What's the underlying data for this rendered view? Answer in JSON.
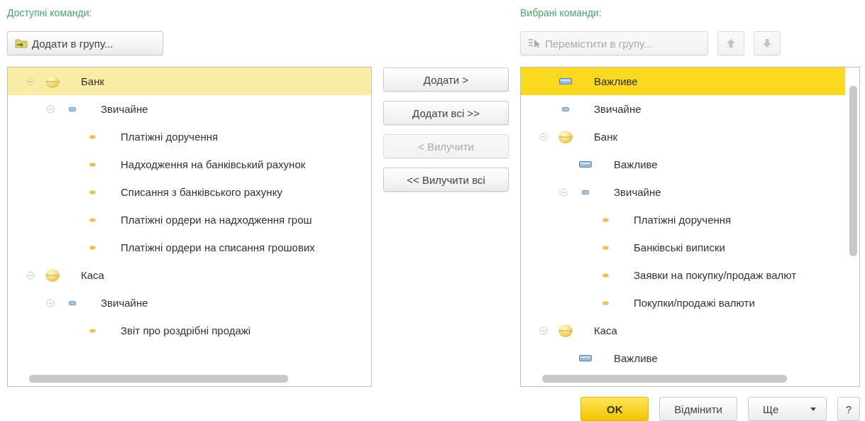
{
  "available": {
    "label": "Доступні команди:",
    "toolbar": [
      {
        "kind": "add-group",
        "label": "Додати в групу...",
        "disabled": false
      }
    ],
    "tree": {
      "focused": false,
      "items": [
        {
          "kind": "group",
          "label": "Банк",
          "selected": true,
          "expanded": true,
          "children": [
            {
              "kind": "normal",
              "label": "Звичайне",
              "selected": false,
              "expanded": true,
              "children": [
                {
                  "kind": "command",
                  "label": "Платіжні доручення",
                  "selected": false
                },
                {
                  "kind": "command",
                  "label": "Надходження на банківський рахунок",
                  "selected": false
                },
                {
                  "kind": "command",
                  "label": "Списання з банківського рахунку",
                  "selected": false
                },
                {
                  "kind": "command",
                  "label": "Платіжні ордери на надходження грош",
                  "selected": false
                },
                {
                  "kind": "command",
                  "label": "Платіжні ордери на списання грошових",
                  "selected": false
                }
              ]
            }
          ]
        },
        {
          "kind": "group",
          "label": "Каса",
          "selected": false,
          "expanded": true,
          "children": [
            {
              "kind": "normal",
              "label": "Звичайне",
              "selected": false,
              "expanded": true,
              "children": [
                {
                  "kind": "command",
                  "label": "Звіт про роздрібні продажі",
                  "selected": false
                }
              ]
            }
          ]
        }
      ]
    }
  },
  "transfer_buttons": [
    {
      "label": "Додати >",
      "disabled": false
    },
    {
      "label": "Додати всі >>",
      "disabled": false
    },
    {
      "label": "< Вилучити",
      "disabled": true
    },
    {
      "label": "<< Вилучити всі",
      "disabled": false
    }
  ],
  "selected": {
    "label": "Вибрані команди:",
    "toolbar": [
      {
        "kind": "move-group",
        "label": "Перемістити в групу...",
        "disabled": true
      },
      {
        "kind": "up",
        "disabled": true
      },
      {
        "kind": "down",
        "disabled": true
      }
    ],
    "tree": {
      "focused": true,
      "items": [
        {
          "kind": "important",
          "label": "Важливе",
          "selected": true
        },
        {
          "kind": "normal",
          "label": "Звичайне",
          "selected": false
        },
        {
          "kind": "group",
          "label": "Банк",
          "selected": false,
          "expanded": true,
          "children": [
            {
              "kind": "important",
              "label": "Важливе",
              "selected": false
            },
            {
              "kind": "normal",
              "label": "Звичайне",
              "selected": false,
              "expanded": true,
              "children": [
                {
                  "kind": "command",
                  "label": "Платіжні доручення",
                  "selected": false
                },
                {
                  "kind": "command",
                  "label": "Банківські виписки",
                  "selected": false
                },
                {
                  "kind": "command",
                  "label": "Заявки на покупку/продаж валют",
                  "selected": false
                },
                {
                  "kind": "command",
                  "label": "Покупки/продажі валюти",
                  "selected": false
                }
              ]
            }
          ]
        },
        {
          "kind": "group",
          "label": "Каса",
          "selected": false,
          "expanded": true,
          "children": [
            {
              "kind": "important",
              "label": "Важливе",
              "selected": false
            }
          ]
        }
      ]
    }
  },
  "footer": [
    {
      "kind": "primary",
      "label": "OK"
    },
    {
      "kind": "plain",
      "label": "Відмінити"
    },
    {
      "kind": "menu",
      "label": "Ще"
    },
    {
      "kind": "plain",
      "label": "?"
    }
  ]
}
